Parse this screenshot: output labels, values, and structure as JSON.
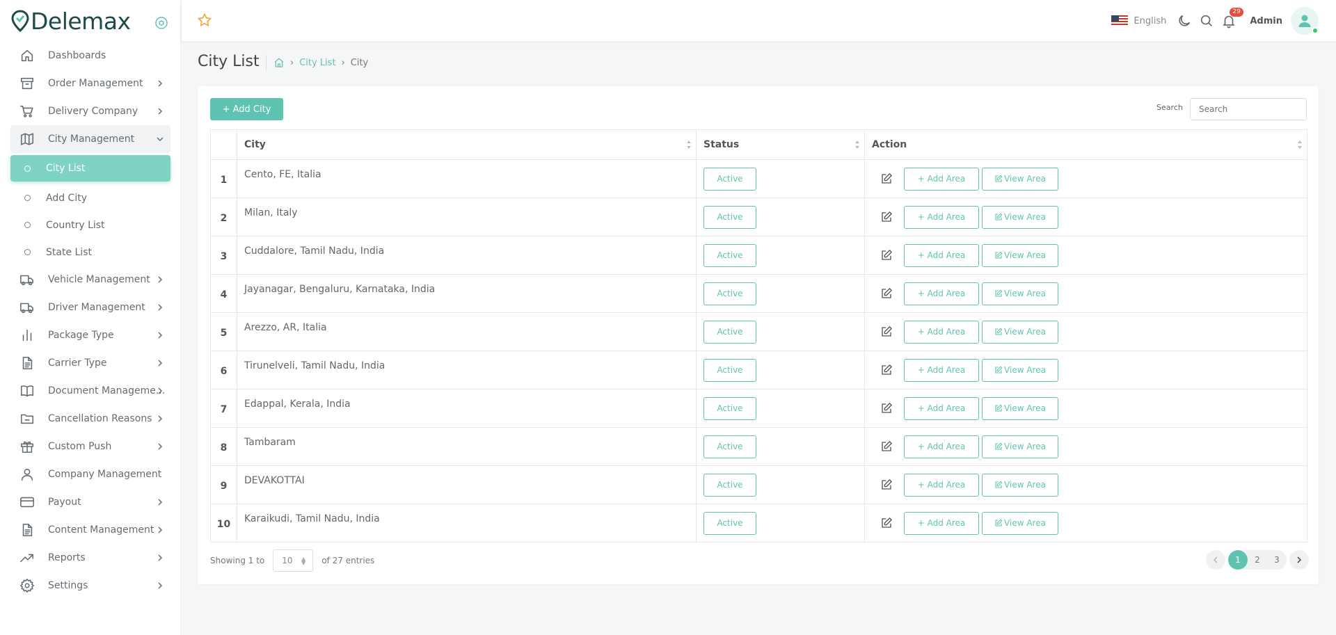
{
  "app": {
    "name": "Delemax"
  },
  "sidebar": {
    "items": [
      {
        "label": "Dashboards",
        "icon": "home-icon",
        "chevron": false
      },
      {
        "label": "Order Management",
        "icon": "archive-icon",
        "chevron": true
      },
      {
        "label": "Delivery Company",
        "icon": "cart-icon",
        "chevron": true
      },
      {
        "label": "City Management",
        "icon": "map-icon",
        "chevron": true,
        "open": true
      },
      {
        "label": "Vehicle Management",
        "icon": "truck-icon",
        "chevron": true
      },
      {
        "label": "Driver Management",
        "icon": "truck-icon",
        "chevron": true
      },
      {
        "label": "Package Type",
        "icon": "bar-chart-icon",
        "chevron": true
      },
      {
        "label": "Carrier Type",
        "icon": "document-icon",
        "chevron": true
      },
      {
        "label": "Document Manageme...",
        "icon": "book-icon",
        "chevron": true
      },
      {
        "label": "Cancellation Reasons",
        "icon": "folder-icon",
        "chevron": true
      },
      {
        "label": "Custom Push",
        "icon": "gift-icon",
        "chevron": true
      },
      {
        "label": "Company Management",
        "icon": "user-icon",
        "chevron": false
      },
      {
        "label": "Payout",
        "icon": "credit-card-icon",
        "chevron": true
      },
      {
        "label": "Content Management",
        "icon": "document-icon",
        "chevron": true
      },
      {
        "label": "Reports",
        "icon": "trending-up-icon",
        "chevron": true
      },
      {
        "label": "Settings",
        "icon": "gear-icon",
        "chevron": true
      }
    ],
    "submenu": [
      {
        "label": "City List",
        "active": true
      },
      {
        "label": "Add City",
        "active": false
      },
      {
        "label": "Country List",
        "active": false
      },
      {
        "label": "State List",
        "active": false
      }
    ]
  },
  "header": {
    "language": "English",
    "notification_count": "29",
    "user": "Admin"
  },
  "page": {
    "title": "City List",
    "breadcrumb": [
      "City List",
      "City"
    ]
  },
  "toolbar": {
    "add_label": "+ Add City",
    "search_label": "Search",
    "search_placeholder": "Search"
  },
  "table": {
    "columns": [
      "City",
      "Status",
      "Action"
    ],
    "add_area_label": "+ Add Area",
    "view_area_label": "View Area",
    "rows": [
      {
        "num": "1",
        "city": "Cento, FE, Italia",
        "status": "Active"
      },
      {
        "num": "2",
        "city": "Milan, Italy",
        "status": "Active"
      },
      {
        "num": "3",
        "city": "Cuddalore, Tamil Nadu, India",
        "status": "Active"
      },
      {
        "num": "4",
        "city": "Jayanagar, Bengaluru, Karnataka, India",
        "status": "Active"
      },
      {
        "num": "5",
        "city": "Arezzo, AR, Italia",
        "status": "Active"
      },
      {
        "num": "6",
        "city": "Tirunelveli, Tamil Nadu, India",
        "status": "Active"
      },
      {
        "num": "7",
        "city": "Edappal, Kerala, India",
        "status": "Active"
      },
      {
        "num": "8",
        "city": "Tambaram",
        "status": "Active"
      },
      {
        "num": "9",
        "city": "DEVAKOTTAI",
        "status": "Active"
      },
      {
        "num": "10",
        "city": "Karaikudi, Tamil Nadu, India",
        "status": "Active"
      }
    ]
  },
  "footer": {
    "showing_prefix": "Showing 1 to",
    "page_length": "10",
    "showing_suffix": "of 27 entries",
    "pages": [
      "1",
      "2",
      "3"
    ],
    "current_page": "1"
  },
  "colors": {
    "accent": "#5ec4b1",
    "badge": "#e74c3c",
    "star": "#f0a93b"
  }
}
